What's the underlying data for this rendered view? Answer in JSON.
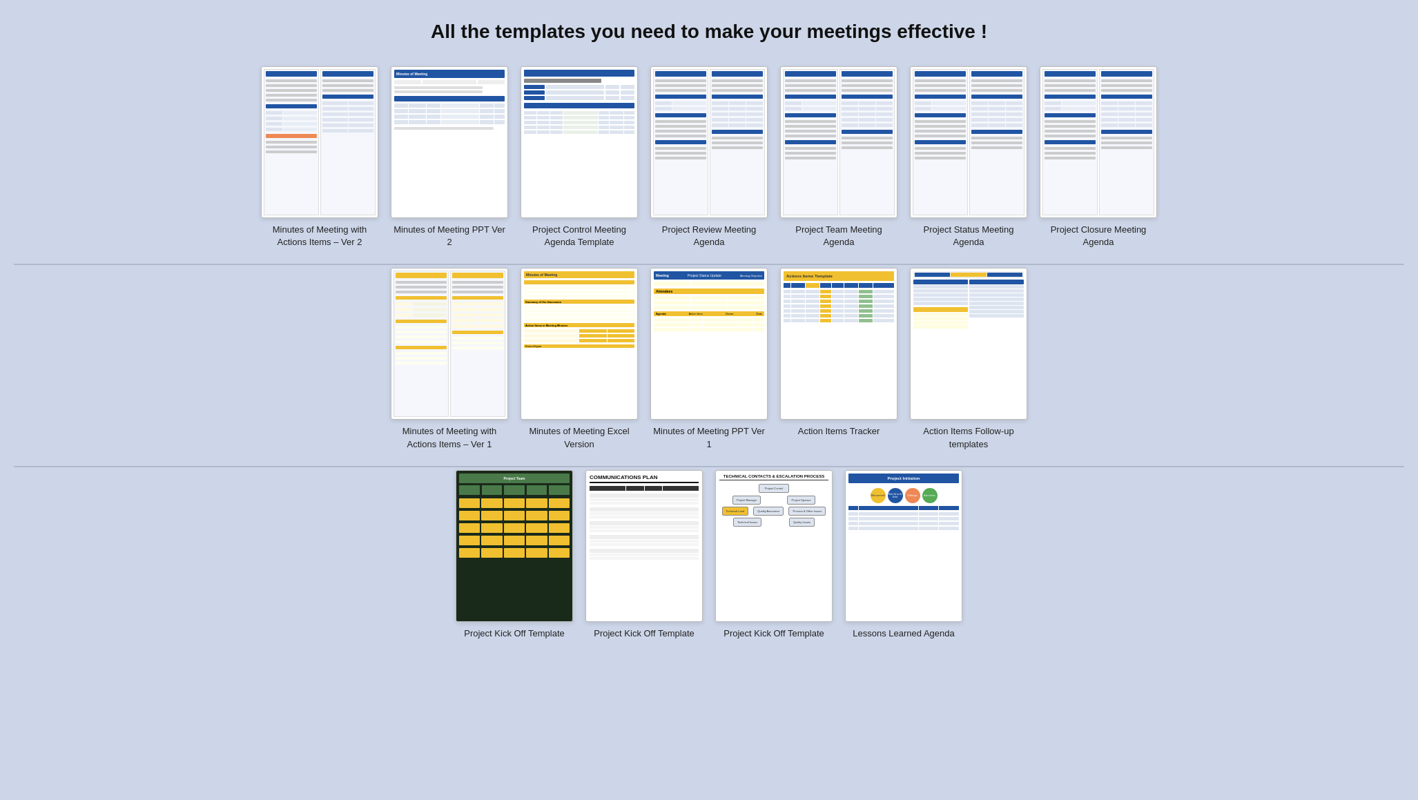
{
  "page": {
    "title": "All the templates you need to make your meetings effective !"
  },
  "rows": [
    {
      "cards": [
        {
          "id": "minutes-v2",
          "label": "Minutes of Meeting with\nActions Items – Ver 2",
          "type": "double-minutes"
        },
        {
          "id": "minutes-ppt-v2",
          "label": "Minutes of Meeting PPT\nVer 2",
          "type": "ppt-minutes"
        },
        {
          "id": "project-control",
          "label": "Project Control Meeting\nAgenda Template",
          "type": "agenda-control"
        },
        {
          "id": "project-review",
          "label": "Project Review\nMeeting Agenda",
          "type": "agenda-review"
        },
        {
          "id": "project-team",
          "label": "Project Team\nMeeting Agenda",
          "type": "agenda-team"
        },
        {
          "id": "project-status",
          "label": "Project Status\nMeeting Agenda",
          "type": "agenda-status"
        },
        {
          "id": "project-closure",
          "label": "Project Closure\nMeeting Agenda",
          "type": "agenda-closure"
        }
      ]
    },
    {
      "cards": [
        {
          "id": "minutes-actions-v1",
          "label": "Minutes of Meeting with\nActions Items – Ver 1",
          "type": "double-minutes-yellow"
        },
        {
          "id": "minutes-excel",
          "label": "Minutes of Meeting Excel\nVersion",
          "type": "excel-minutes"
        },
        {
          "id": "minutes-ppt-v1",
          "label": "Minutes of Meeting PPT\nVer 1",
          "type": "ppt-minutes-v1"
        },
        {
          "id": "action-tracker",
          "label": "Action Items Tracker",
          "type": "action-tracker"
        },
        {
          "id": "action-followup",
          "label": "Action Items Follow-up\ntemplates",
          "type": "action-followup"
        }
      ]
    },
    {
      "cards": [
        {
          "id": "kickoff-1",
          "label": "Project Kick Off Template",
          "type": "kickoff-dark"
        },
        {
          "id": "kickoff-2",
          "label": "Project Kick Off Template",
          "type": "kickoff-comms"
        },
        {
          "id": "kickoff-3",
          "label": "Project Kick Off Template",
          "type": "kickoff-escalation"
        },
        {
          "id": "lessons-learned",
          "label": "Lessons Learned Agenda",
          "type": "lessons-learned"
        }
      ]
    }
  ]
}
